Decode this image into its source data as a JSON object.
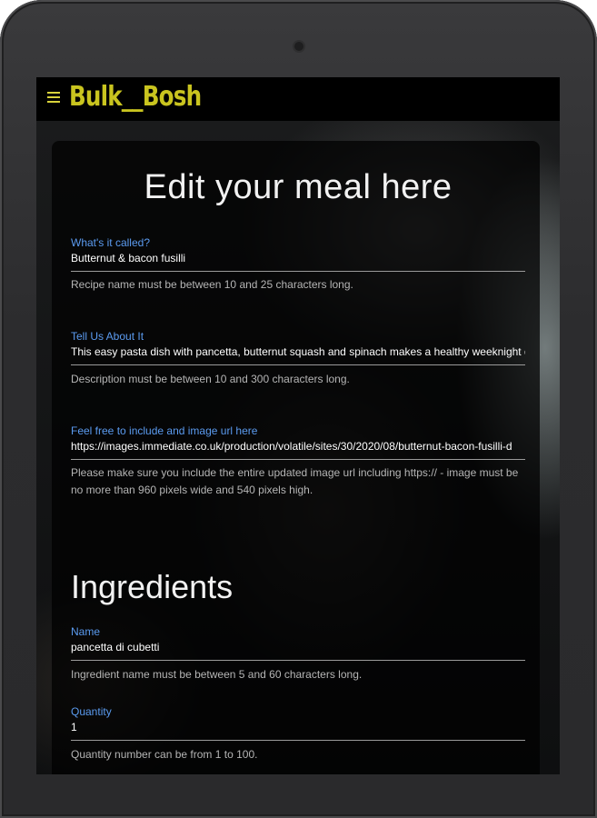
{
  "navbar": {
    "brand": "Bulk__Bosh"
  },
  "form": {
    "title": "Edit your meal here",
    "name": {
      "label": "What's it called?",
      "value": "Butternut & bacon fusilli",
      "helper": "Recipe name must be between 10 and 25 characters long."
    },
    "description": {
      "label": "Tell Us About It",
      "value": "This easy pasta dish with pancetta, butternut squash and spinach makes a healthy weeknight di",
      "helper": "Description must be between 10 and 300 characters long."
    },
    "image_url": {
      "label": "Feel free to include and image url here",
      "value": "https://images.immediate.co.uk/production/volatile/sites/30/2020/08/butternut-bacon-fusilli-d",
      "helper_line1": "Please make sure you include the entire updated image url including https:// - image must be",
      "helper_line2": "no more than 960 pixels wide and 540 pixels high."
    }
  },
  "ingredients": {
    "title": "Ingredients",
    "name": {
      "label": "Name",
      "value": "pancetta di cubetti",
      "helper": "Ingredient name must be between 5 and 60 characters long."
    },
    "quantity": {
      "label": "Quantity",
      "value": "1",
      "helper": "Quantity number can be from 1 to 100."
    }
  }
}
